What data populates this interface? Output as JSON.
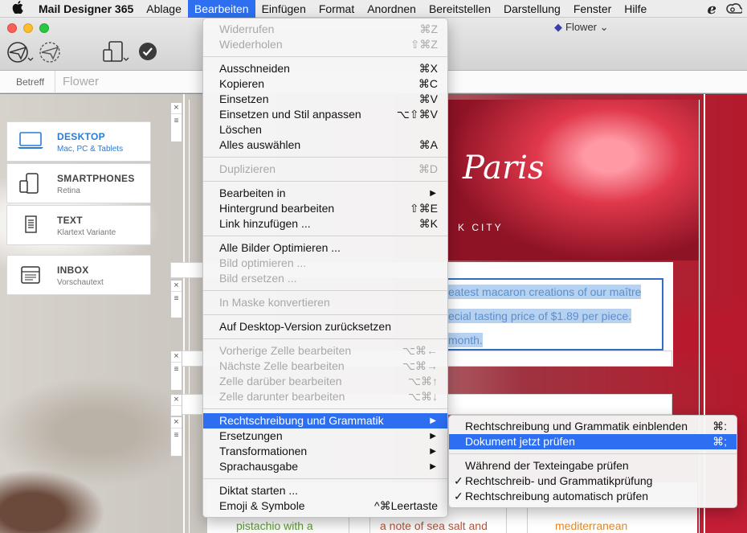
{
  "menubar": {
    "apple_icon": "apple-icon",
    "app_name": "Mail Designer 365",
    "items": [
      "Ablage",
      "Bearbeiten",
      "Einfügen",
      "Format",
      "Anordnen",
      "Bereitstellen",
      "Darstellung",
      "Fenster",
      "Hilfe"
    ],
    "active": "Bearbeiten",
    "e_icon_glyph": "e"
  },
  "window": {
    "doc_title": "Flower",
    "doc_title_chevron": "⌄"
  },
  "subject": {
    "label": "Betreff",
    "value": "Flower"
  },
  "devices": [
    {
      "title": "DESKTOP",
      "subtitle": "Mac, PC & Tablets",
      "icon": "laptop-icon",
      "selected": true
    },
    {
      "title": "SMARTPHONES",
      "subtitle": "Retina",
      "icon": "smartphones-icon",
      "selected": false
    },
    {
      "title": "TEXT",
      "subtitle": "Klartext Variante",
      "icon": "text-document-icon",
      "selected": false
    },
    {
      "title": "INBOX",
      "subtitle": "Vorschautext",
      "icon": "inbox-icon",
      "selected": false
    }
  ],
  "template": {
    "hero_title": "Paris",
    "hero_sub": "K CITY",
    "text_lines": [
      "eatest macaron creations of our maître",
      "ecial tasting price of $1.89 per piece.",
      "month."
    ],
    "bottom_texts": [
      "pistachio with a",
      "a note of sea salt and",
      "mediterranean"
    ],
    "colors": {
      "green": "#5aa130",
      "brown": "#b3543a",
      "orange": "#e08a2a"
    }
  },
  "edit_menu": {
    "sections": [
      [
        {
          "label": "Widerrufen",
          "shortcut": "⌘Z",
          "disabled": true
        },
        {
          "label": "Wiederholen",
          "shortcut": "⇧⌘Z",
          "disabled": true
        }
      ],
      [
        {
          "label": "Ausschneiden",
          "shortcut": "⌘X"
        },
        {
          "label": "Kopieren",
          "shortcut": "⌘C"
        },
        {
          "label": "Einsetzen",
          "shortcut": "⌘V"
        },
        {
          "label": "Einsetzen und Stil anpassen",
          "shortcut": "⌥⇧⌘V"
        },
        {
          "label": "Löschen",
          "shortcut": ""
        },
        {
          "label": "Alles auswählen",
          "shortcut": "⌘A"
        }
      ],
      [
        {
          "label": "Duplizieren",
          "shortcut": "⌘D",
          "disabled": true
        }
      ],
      [
        {
          "label": "Bearbeiten in",
          "shortcut": "",
          "submenu": true
        },
        {
          "label": "Hintergrund bearbeiten",
          "shortcut": "⇧⌘E"
        },
        {
          "label": "Link hinzufügen ...",
          "shortcut": "⌘K"
        }
      ],
      [
        {
          "label": "Alle Bilder Optimieren ...",
          "shortcut": ""
        },
        {
          "label": "Bild optimieren ...",
          "shortcut": "",
          "disabled": true
        },
        {
          "label": "Bild ersetzen ...",
          "shortcut": "",
          "disabled": true
        }
      ],
      [
        {
          "label": "In Maske konvertieren",
          "shortcut": "",
          "disabled": true
        }
      ],
      [
        {
          "label": "Auf Desktop-Version zurücksetzen",
          "shortcut": ""
        }
      ],
      [
        {
          "label": "Vorherige Zelle bearbeiten",
          "shortcut": "⌥⌘←",
          "disabled": true
        },
        {
          "label": "Nächste Zelle bearbeiten",
          "shortcut": "⌥⌘→",
          "disabled": true
        },
        {
          "label": "Zelle darüber bearbeiten",
          "shortcut": "⌥⌘↑",
          "disabled": true
        },
        {
          "label": "Zelle darunter bearbeiten",
          "shortcut": "⌥⌘↓",
          "disabled": true
        }
      ],
      [
        {
          "label": "Rechtschreibung und Grammatik",
          "shortcut": "",
          "submenu": true,
          "highlighted": true
        },
        {
          "label": "Ersetzungen",
          "shortcut": "",
          "submenu": true
        },
        {
          "label": "Transformationen",
          "shortcut": "",
          "submenu": true
        },
        {
          "label": "Sprachausgabe",
          "shortcut": "",
          "submenu": true
        }
      ],
      [
        {
          "label": "Diktat starten ...",
          "shortcut": ""
        },
        {
          "label": "Emoji & Symbole",
          "shortcut": "^⌘Leertaste"
        }
      ]
    ]
  },
  "spelling_submenu": {
    "sections": [
      [
        {
          "label": "Rechtschreibung und Grammatik einblenden",
          "shortcut": "⌘:"
        },
        {
          "label": "Dokument jetzt prüfen",
          "shortcut": "⌘;",
          "highlighted": true
        }
      ],
      [
        {
          "label": "Während der Texteingabe prüfen",
          "shortcut": "",
          "checked": false
        },
        {
          "label": "Rechtschreib- und Grammatikprüfung",
          "shortcut": "",
          "checked": true
        },
        {
          "label": "Rechtschreibung automatisch prüfen",
          "shortcut": "",
          "checked": true
        }
      ]
    ],
    "check_glyph": "✓",
    "submenu_arrow": "▶"
  }
}
